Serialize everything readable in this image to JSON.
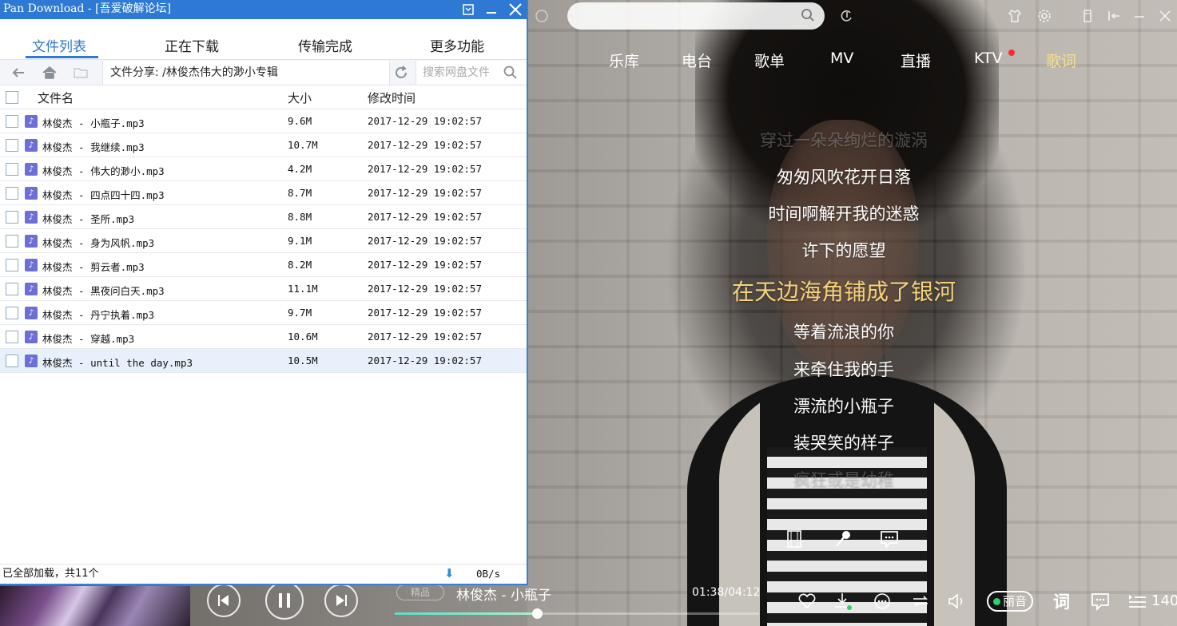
{
  "pan_window": {
    "title": "Pan Download - [吾爱破解论坛]",
    "tabs": [
      "文件列表",
      "正在下载",
      "传输完成",
      "更多功能"
    ],
    "active_tab": "文件列表",
    "path": "文件分享: /林俊杰伟大的渺小专辑",
    "search_placeholder": "搜索网盘文件",
    "columns": {
      "name": "文件名",
      "size": "大小",
      "modified": "修改时间"
    },
    "files": [
      {
        "name": "林俊杰 - 小瓶子.mp3",
        "size": "9.6M",
        "modified": "2017-12-29 19:02:57"
      },
      {
        "name": "林俊杰 - 我继续.mp3",
        "size": "10.7M",
        "modified": "2017-12-29 19:02:57"
      },
      {
        "name": "林俊杰 - 伟大的渺小.mp3",
        "size": "4.2M",
        "modified": "2017-12-29 19:02:57"
      },
      {
        "name": "林俊杰 - 四点四十四.mp3",
        "size": "8.7M",
        "modified": "2017-12-29 19:02:57"
      },
      {
        "name": "林俊杰 - 圣所.mp3",
        "size": "8.8M",
        "modified": "2017-12-29 19:02:57"
      },
      {
        "name": "林俊杰 - 身为风帆.mp3",
        "size": "9.1M",
        "modified": "2017-12-29 19:02:57"
      },
      {
        "name": "林俊杰 - 剪云者.mp3",
        "size": "8.2M",
        "modified": "2017-12-29 19:02:57"
      },
      {
        "name": "林俊杰 - 黑夜问白天.mp3",
        "size": "11.1M",
        "modified": "2017-12-29 19:02:57"
      },
      {
        "name": "林俊杰 - 丹宁执着.mp3",
        "size": "9.7M",
        "modified": "2017-12-29 19:02:57"
      },
      {
        "name": "林俊杰 - 穿越.mp3",
        "size": "10.6M",
        "modified": "2017-12-29 19:02:57"
      },
      {
        "name": "林俊杰 - until the day.mp3",
        "size": "10.5M",
        "modified": "2017-12-29 19:02:57"
      }
    ],
    "selected_index": 10,
    "status_text": "已全部加载，共11个",
    "speed": "0B/s",
    "accent_color": "#2d79d3",
    "file_icon": "music-note-icon"
  },
  "player": {
    "nav": [
      "乐库",
      "电台",
      "歌单",
      "MV",
      "直播",
      "KTV",
      "歌词"
    ],
    "active_nav": "歌词",
    "lyrics": [
      {
        "text": "穿过一朵朵绚烂的漩涡",
        "state": "dim"
      },
      {
        "text": "匆匆风吹花开日落",
        "state": "normal"
      },
      {
        "text": "时间啊解开我的迷惑",
        "state": "normal"
      },
      {
        "text": "许下的愿望",
        "state": "normal"
      },
      {
        "text": "在天边海角铺成了银河",
        "state": "current"
      },
      {
        "text": "等着流浪的你",
        "state": "normal"
      },
      {
        "text": "来牵住我的手",
        "state": "normal"
      },
      {
        "text": "漂流的小瓶子",
        "state": "normal"
      },
      {
        "text": "装哭笑的样子",
        "state": "normal"
      },
      {
        "text": "疯狂或是幼稚",
        "state": "dim"
      }
    ],
    "now_playing": "林俊杰 - 小瓶子",
    "quality_tag": "精品",
    "time": "01:38/04:12",
    "progress_fraction": 0.39,
    "sound_effect": "丽音",
    "lyrics_button": "词",
    "playlist_count": "140",
    "highlight_color": "#f6d27a",
    "nav_active_color": "#f6e08e"
  }
}
